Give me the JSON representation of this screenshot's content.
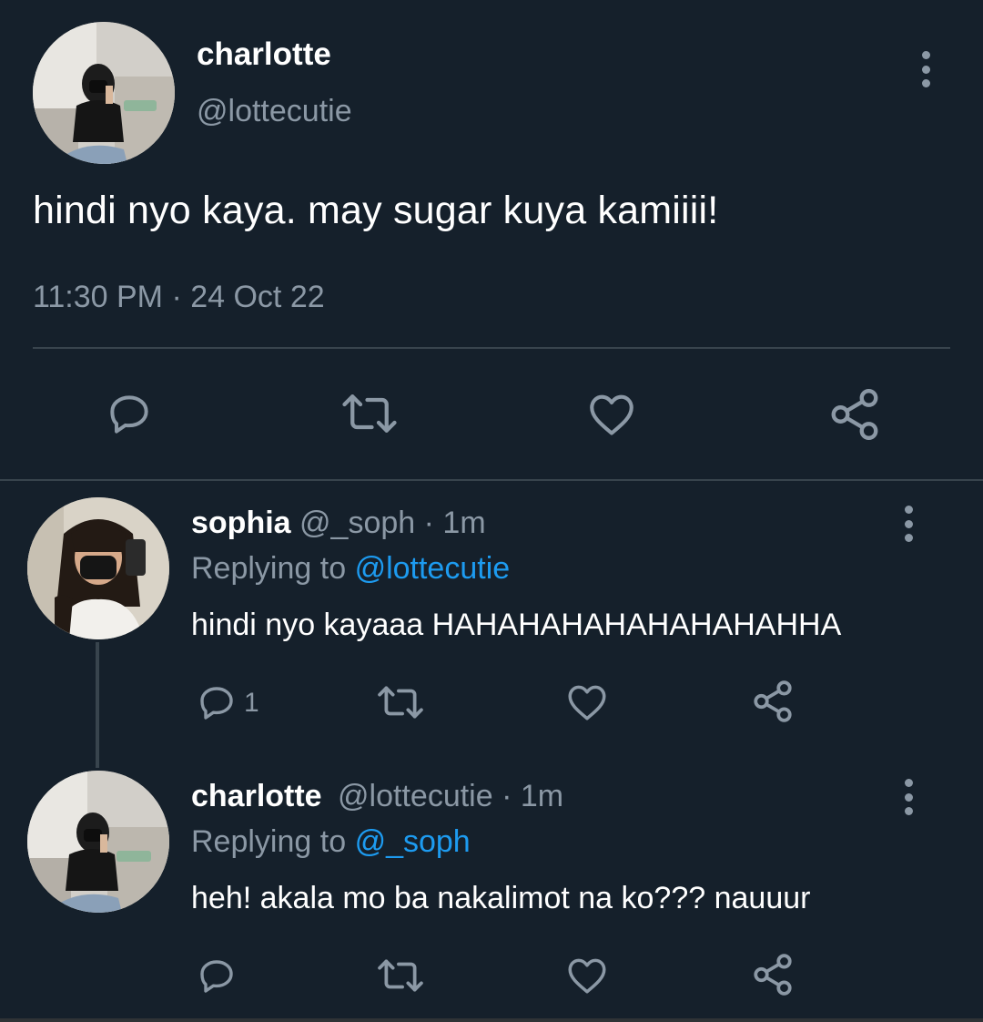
{
  "main_tweet": {
    "name": "charlotte",
    "handle": "@lottecutie",
    "text": "hindi nyo kaya. may sugar kuya kamiiii!",
    "timestamp": "11:30 PM · 24 Oct 22",
    "icons": [
      "comment-icon",
      "retweet-icon",
      "like-icon",
      "share-icon",
      "more-icon"
    ]
  },
  "replies": [
    {
      "name": "sophia",
      "handle": "@_soph",
      "time": "· 1m",
      "replying_prefix": "Replying to",
      "replying_to": "@lottecutie",
      "text": "hindi nyo kayaaa HAHAHAHAHAHAHAHAHHA",
      "reply_count": "1"
    },
    {
      "name": "charlotte",
      "handle": "@lottecutie",
      "time": "· 1m",
      "replying_prefix": "Replying to",
      "replying_to": "@_soph",
      "text": "heh! akala mo ba nakalimot na ko??? nauuur",
      "reply_count": ""
    }
  ],
  "colors": {
    "background": "#15202b",
    "text": "#ffffff",
    "secondary": "#8b98a5",
    "link": "#1d9bf0",
    "divider": "#38444d"
  }
}
